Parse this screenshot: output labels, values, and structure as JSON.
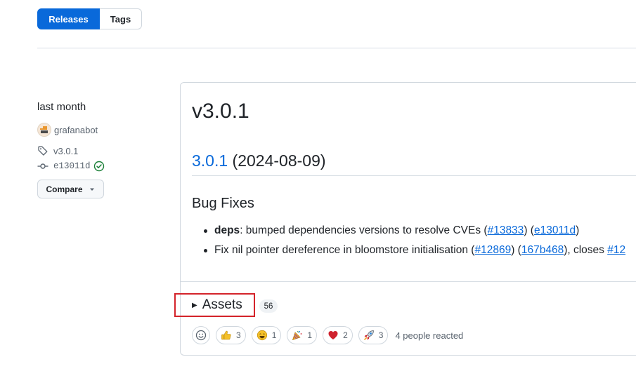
{
  "tabs": {
    "releases_label": "Releases",
    "tags_label": "Tags"
  },
  "meta": {
    "time": "last month",
    "author": "grafanabot",
    "tag": "v3.0.1",
    "commit": "e13011d",
    "compare_label": "Compare",
    "icons": {
      "tag": "tag-icon",
      "commit": "git-commit-icon",
      "verified": "check-circle-icon",
      "caret": "triangle-down-icon"
    }
  },
  "release": {
    "title": "v3.0.1",
    "version_link": "3.0.1",
    "date": "(2024-08-09)",
    "section": "Bug Fixes",
    "notes": [
      {
        "bold": "deps",
        "colon": ":",
        "text": " bumped dependencies versions to resolve CVEs (",
        "link1": "#13833",
        "mid": ") (",
        "link2": "e13011d",
        "end": ")"
      },
      {
        "text": "Fix nil pointer dereference in bloomstore initialisation (",
        "link1": "#12869",
        "mid": ") (",
        "link2": "167b468",
        "mid2": "), closes ",
        "link3": "#12"
      }
    ]
  },
  "assets": {
    "label": "Assets",
    "count": "56"
  },
  "reactions": {
    "items": [
      {
        "icon": "thumbs-up-icon",
        "count": "3"
      },
      {
        "icon": "smile-icon",
        "count": "1"
      },
      {
        "icon": "tada-icon",
        "count": "1"
      },
      {
        "icon": "heart-icon",
        "count": "2"
      },
      {
        "icon": "rocket-icon",
        "count": "3"
      }
    ],
    "summary": "4 people reacted",
    "colors": {
      "heart": "#cf222e",
      "yellow": "#f4c029"
    }
  },
  "colors": {
    "accent": "#0969da",
    "highlight": "#d4232a",
    "verified": "#1a7f37"
  }
}
